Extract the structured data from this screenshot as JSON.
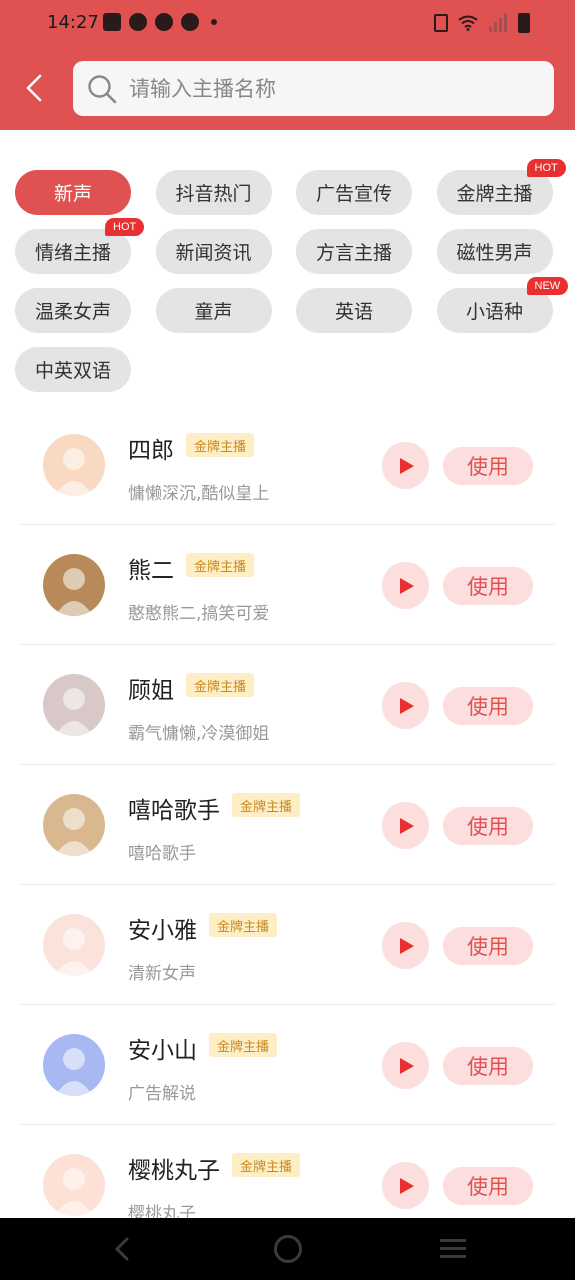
{
  "status": {
    "time": "14:27"
  },
  "search": {
    "placeholder": "请输入主播名称"
  },
  "chips": [
    {
      "label": "新声",
      "active": true,
      "tag": ""
    },
    {
      "label": "抖音热门",
      "active": false,
      "tag": ""
    },
    {
      "label": "广告宣传",
      "active": false,
      "tag": ""
    },
    {
      "label": "金牌主播",
      "active": false,
      "tag": "HOT"
    },
    {
      "label": "情绪主播",
      "active": false,
      "tag": "HOT"
    },
    {
      "label": "新闻资讯",
      "active": false,
      "tag": ""
    },
    {
      "label": "方言主播",
      "active": false,
      "tag": ""
    },
    {
      "label": "磁性男声",
      "active": false,
      "tag": ""
    },
    {
      "label": "温柔女声",
      "active": false,
      "tag": ""
    },
    {
      "label": "童声",
      "active": false,
      "tag": ""
    },
    {
      "label": "英语",
      "active": false,
      "tag": ""
    },
    {
      "label": "小语种",
      "active": false,
      "tag": "NEW"
    },
    {
      "label": "中英双语",
      "active": false,
      "tag": ""
    }
  ],
  "anchors": [
    {
      "name": "四郎",
      "badge": "金牌主播",
      "desc": "慵懒深沉,酷似皇上",
      "avatar_color": "#f9d9c2"
    },
    {
      "name": "熊二",
      "badge": "金牌主播",
      "desc": "憨憨熊二,搞笑可爱",
      "avatar_color": "#b88a5a"
    },
    {
      "name": "顾姐",
      "badge": "金牌主播",
      "desc": "霸气慵懒,冷漠御姐",
      "avatar_color": "#d8c8c8"
    },
    {
      "name": "嘻哈歌手",
      "badge": "金牌主播",
      "desc": "嘻哈歌手",
      "avatar_color": "#d9b890"
    },
    {
      "name": "安小雅",
      "badge": "金牌主播",
      "desc": "清新女声",
      "avatar_color": "#fbe3dc"
    },
    {
      "name": "安小山",
      "badge": "金牌主播",
      "desc": "广告解说",
      "avatar_color": "#a7b8f2"
    },
    {
      "name": "樱桃丸子",
      "badge": "金牌主播",
      "desc": "樱桃丸子",
      "avatar_color": "#fde0d6"
    }
  ],
  "use_label": "使用",
  "colors": {
    "accent": "#e05252",
    "badge_bg": "#fdeec6",
    "badge_text": "#c98a1e",
    "tag": "#e83030"
  }
}
